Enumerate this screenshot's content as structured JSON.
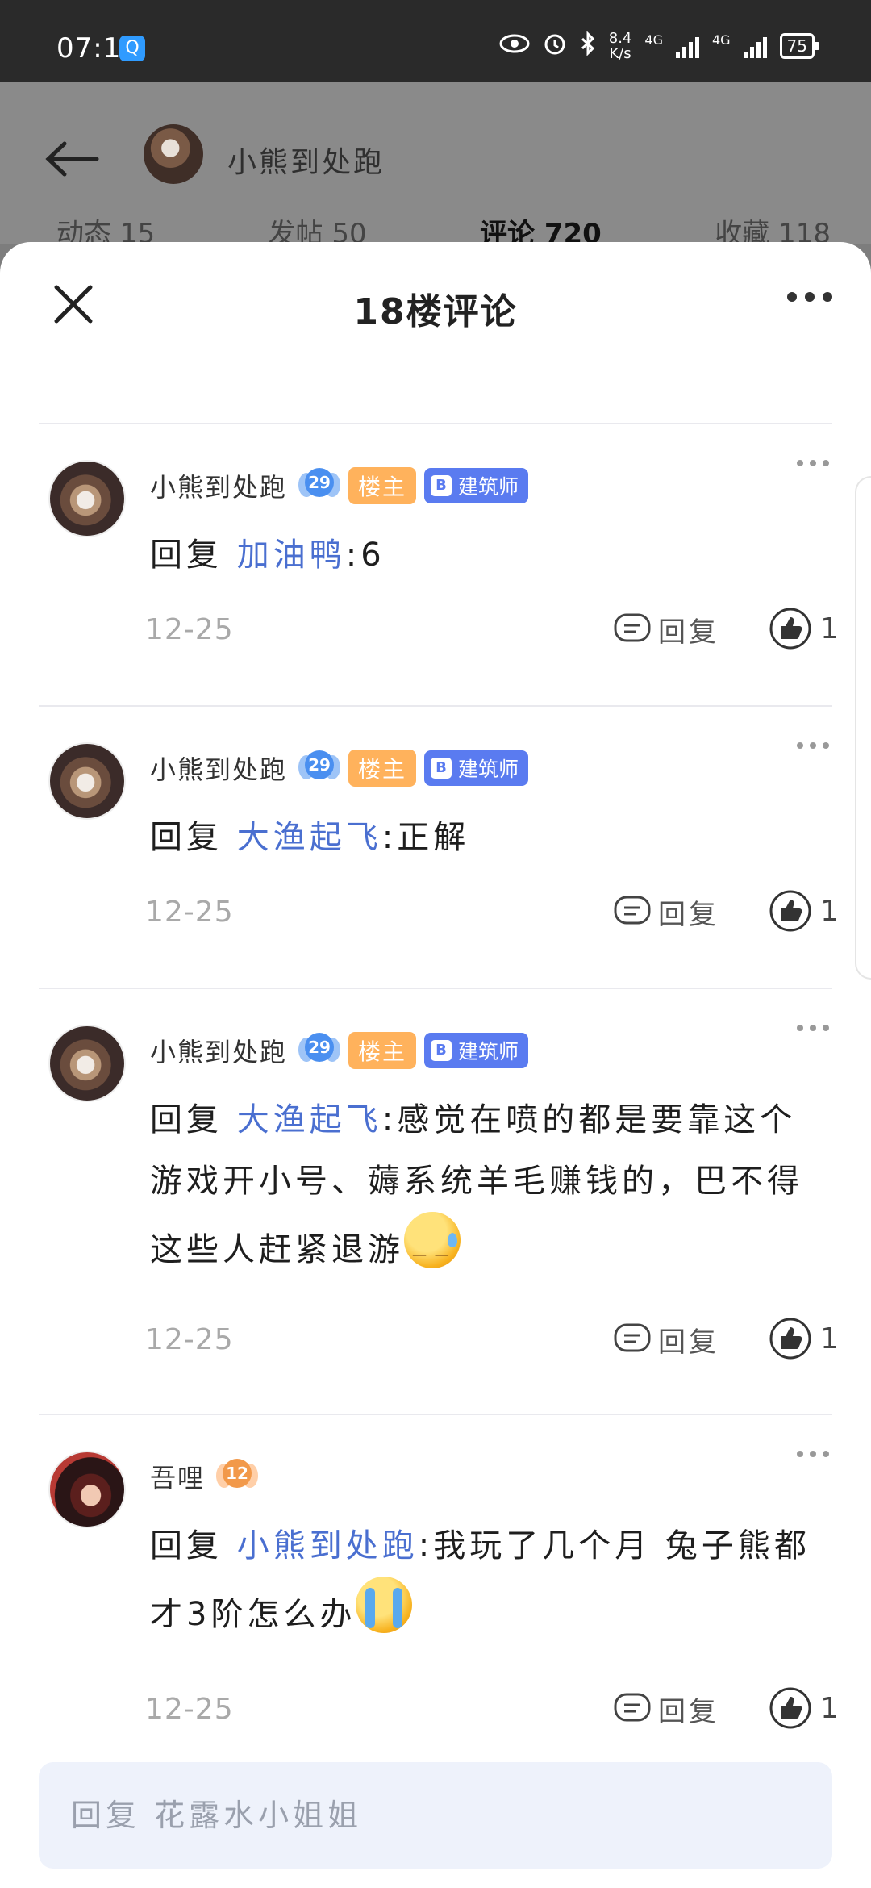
{
  "status_bar": {
    "time": "07:14",
    "speed_value": "8.4",
    "speed_unit": "K/s",
    "net1": "4G",
    "net2": "4G",
    "battery": "75"
  },
  "background": {
    "user_name": "小熊到处跑",
    "tabs": [
      "动态 15",
      "发帖 50",
      "评论 720",
      "收藏 118"
    ]
  },
  "sheet": {
    "title": "18楼评论"
  },
  "comments": [
    {
      "author": "小熊到处跑",
      "level": "29",
      "tag_op": "楼主",
      "tag_role": "建筑师",
      "reply_prefix": "回复",
      "reply_to": "加油鸭",
      "text": ":6",
      "date": "12-25",
      "reply_label": "回复",
      "likes": "1"
    },
    {
      "author": "小熊到处跑",
      "level": "29",
      "tag_op": "楼主",
      "tag_role": "建筑师",
      "reply_prefix": "回复",
      "reply_to": "大渔起飞",
      "text": ":正解",
      "date": "12-25",
      "reply_label": "回复",
      "likes": "1"
    },
    {
      "author": "小熊到处跑",
      "level": "29",
      "tag_op": "楼主",
      "tag_role": "建筑师",
      "reply_prefix": "回复",
      "reply_to": "大渔起飞",
      "text": ":感觉在喷的都是要靠这个游戏开小号、薅系统羊毛赚钱的，巴不得这些人赶紧退游",
      "date": "12-25",
      "reply_label": "回复",
      "likes": "1"
    },
    {
      "author": "吾哩",
      "level": "12",
      "reply_prefix": "回复",
      "reply_to": "小熊到处跑",
      "text": ":我玩了几个月 兔子熊都才3阶怎么办",
      "date": "12-25",
      "reply_label": "回复",
      "likes": "1"
    }
  ],
  "reply_input": {
    "placeholder": "回复 花露水小姐姐"
  }
}
